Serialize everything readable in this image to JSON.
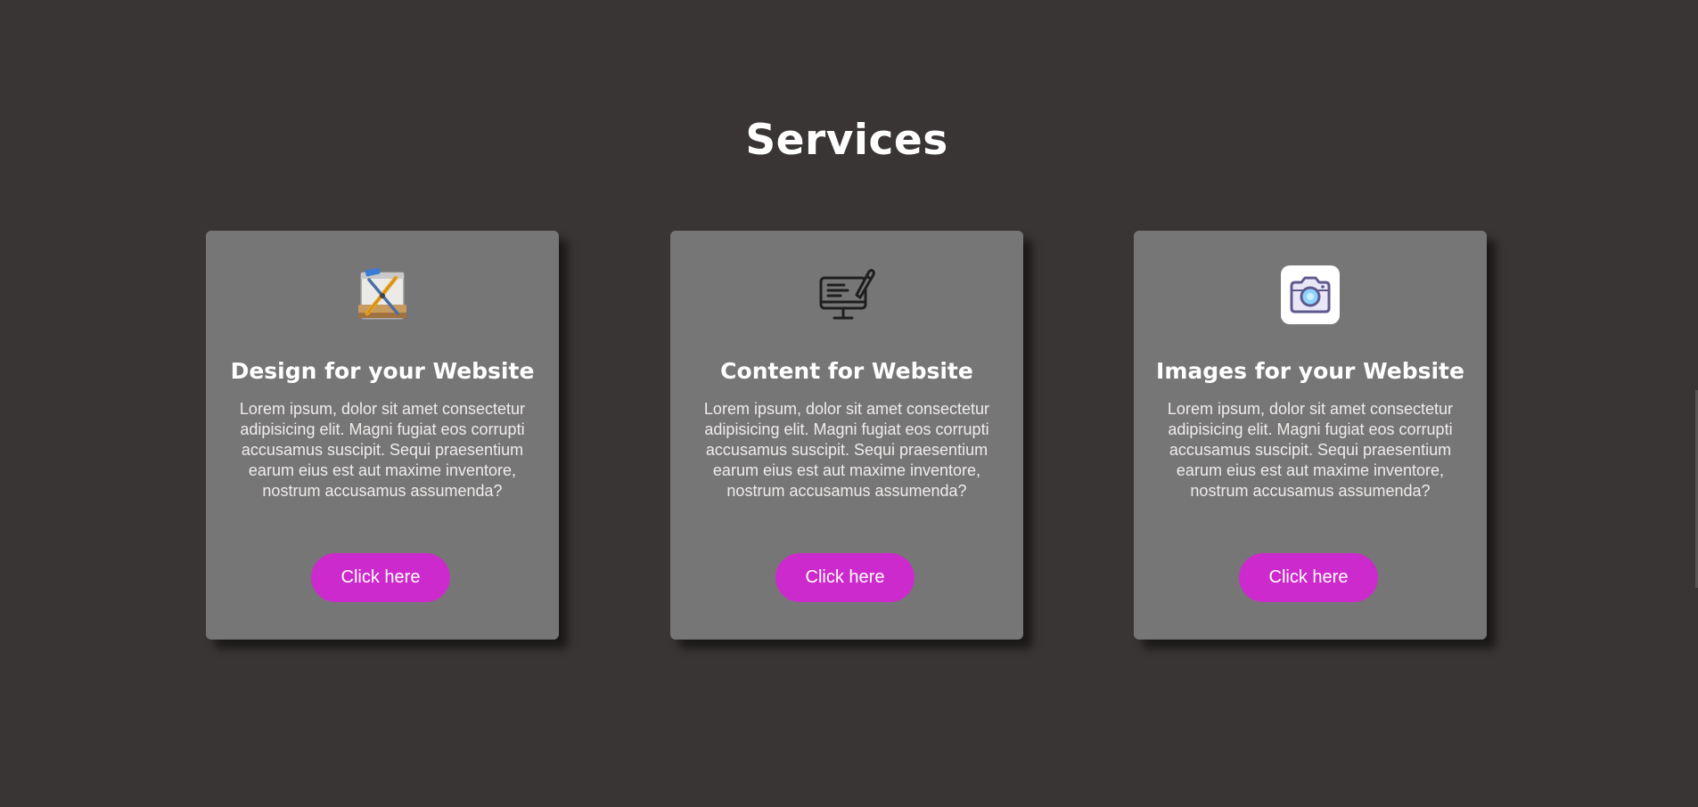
{
  "services": {
    "title": "Services",
    "cards": [
      {
        "icon": "design-tools-icon",
        "title": "Design for your Website",
        "text": "Lorem ipsum, dolor sit amet consectetur adipisicing elit. Magni fugiat eos corrupti accusamus suscipit. Sequi praesentium earum eius est aut maxime inventore, nostrum accusamus assumenda?",
        "button_label": "Click here"
      },
      {
        "icon": "monitor-pen-icon",
        "title": "Content for Website",
        "text": "Lorem ipsum, dolor sit amet consectetur adipisicing elit. Magni fugiat eos corrupti accusamus suscipit. Sequi praesentium earum eius est aut maxime inventore, nostrum accusamus assumenda?",
        "button_label": "Click here"
      },
      {
        "icon": "camera-icon",
        "title": "Images for your Website",
        "text": "Lorem ipsum, dolor sit amet consectetur adipisicing elit. Magni fugiat eos corrupti accusamus suscipit. Sequi praesentium earum eius est aut maxime inventore, nostrum accusamus assumenda?",
        "button_label": "Click here"
      }
    ]
  },
  "colors": {
    "background": "#393534",
    "card_background": "#767676",
    "button": "#cd2acd",
    "heading_text": "#ffffff"
  }
}
